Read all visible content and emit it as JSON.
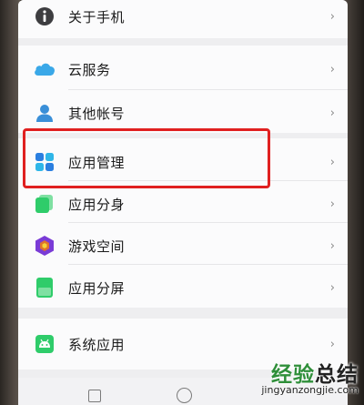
{
  "settings": {
    "about_phone": {
      "label": "关于手机",
      "icon": "info-icon"
    },
    "cloud_service": {
      "label": "云服务",
      "icon": "cloud-icon"
    },
    "other_accounts": {
      "label": "其他帐号",
      "icon": "person-icon"
    },
    "app_management": {
      "label": "应用管理",
      "icon": "apps-grid-icon"
    },
    "app_clone": {
      "label": "应用分身",
      "icon": "app-clone-icon"
    },
    "game_space": {
      "label": "游戏空间",
      "icon": "game-space-icon"
    },
    "app_split_screen": {
      "label": "应用分屏",
      "icon": "split-screen-icon"
    },
    "system_apps": {
      "label": "系统应用",
      "icon": "android-icon"
    },
    "chevron": "›"
  },
  "watermark": {
    "title_green": "经验",
    "title_dark": "总结",
    "url": "jingyanzongjie.com"
  },
  "colors": {
    "highlight": "#e02020",
    "cloud_blue": "#3aa8e8",
    "person_blue": "#3a8fd8",
    "green": "#2fcc6a",
    "purple": "#7a3bd6"
  }
}
